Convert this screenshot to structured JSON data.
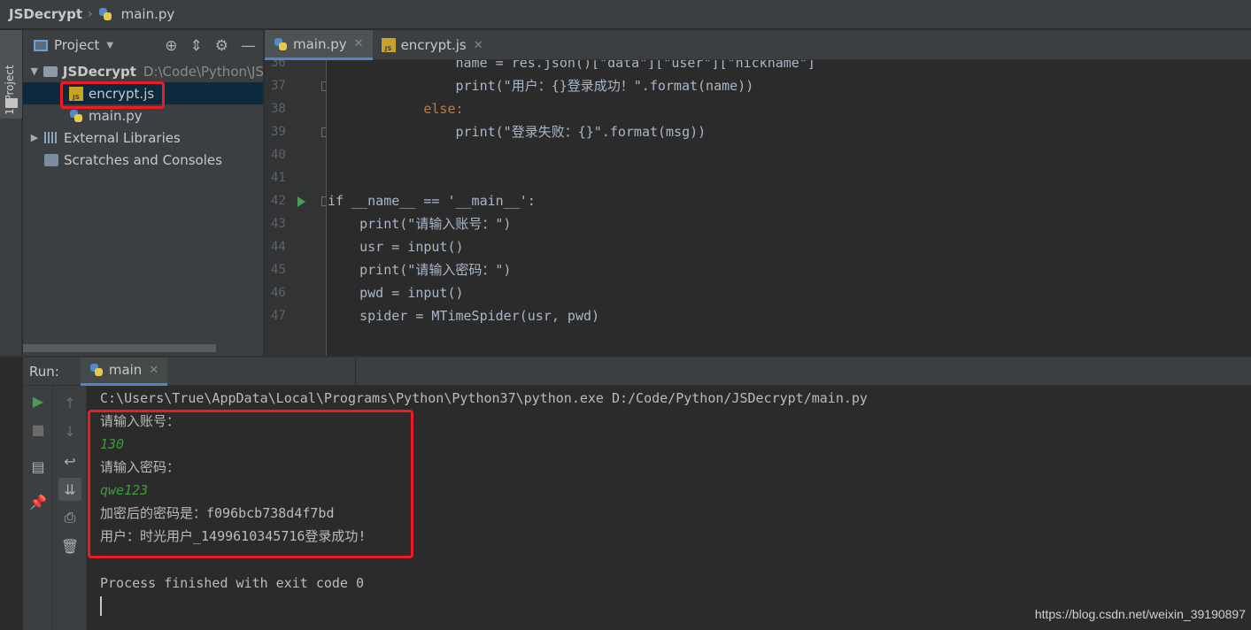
{
  "breadcrumb": {
    "project": "JSDecrypt",
    "file": "main.py"
  },
  "stripe": {
    "project_label": "1: Project"
  },
  "project_panel": {
    "title": "Project",
    "tree": [
      {
        "label": "JSDecrypt",
        "path": "D:\\Code\\Python\\JS",
        "type": "folder",
        "expanded": true
      },
      {
        "label": "encrypt.js",
        "type": "js",
        "selected": true
      },
      {
        "label": "main.py",
        "type": "py"
      },
      {
        "label": "External Libraries",
        "type": "lib"
      },
      {
        "label": "Scratches and Consoles",
        "type": "scratch"
      }
    ]
  },
  "editor": {
    "tabs": [
      {
        "label": "main.py",
        "active": true
      },
      {
        "label": "encrypt.js",
        "active": false
      }
    ],
    "lines": [
      {
        "num": "36",
        "text": "                name = res.json()[\"data\"][\"user\"][\"nickname\"]"
      },
      {
        "num": "37",
        "text": "                print(\"用户：{}登录成功！\".format(name))"
      },
      {
        "num": "38",
        "text": "            else:"
      },
      {
        "num": "39",
        "text": "                print(\"登录失败：{}\".format(msg))"
      },
      {
        "num": "40",
        "text": ""
      },
      {
        "num": "41",
        "text": ""
      },
      {
        "num": "42",
        "text": "if __name__ == '__main__':"
      },
      {
        "num": "43",
        "text": "    print(\"请输入账号：\")"
      },
      {
        "num": "44",
        "text": "    usr = input()"
      },
      {
        "num": "45",
        "text": "    print(\"请输入密码：\")"
      },
      {
        "num": "46",
        "text": "    pwd = input()"
      },
      {
        "num": "47",
        "text": "    spider = MTimeSpider(usr, pwd)"
      }
    ]
  },
  "run": {
    "label": "Run:",
    "tab": "main",
    "console": [
      {
        "text": "C:\\Users\\True\\AppData\\Local\\Programs\\Python\\Python37\\python.exe D:/Code/Python/JSDecrypt/main.py",
        "kind": "out"
      },
      {
        "text": "请输入账号：",
        "kind": "out"
      },
      {
        "text": "130",
        "kind": "in"
      },
      {
        "text": "请输入密码：",
        "kind": "out"
      },
      {
        "text": "qwe123",
        "kind": "in"
      },
      {
        "text": "加密后的密码是：f096bcb738d4f7bd",
        "kind": "out"
      },
      {
        "text": "用户：时光用户_1499610345716登录成功!",
        "kind": "out"
      },
      {
        "text": "",
        "kind": "out"
      },
      {
        "text": "Process finished with exit code 0",
        "kind": "out"
      }
    ]
  },
  "watermark": "https://blog.csdn.net/weixin_39190897",
  "colors": {
    "highlight_box": "#ec1c24",
    "accent": "#4a88c7",
    "selection": "#0d293e"
  }
}
